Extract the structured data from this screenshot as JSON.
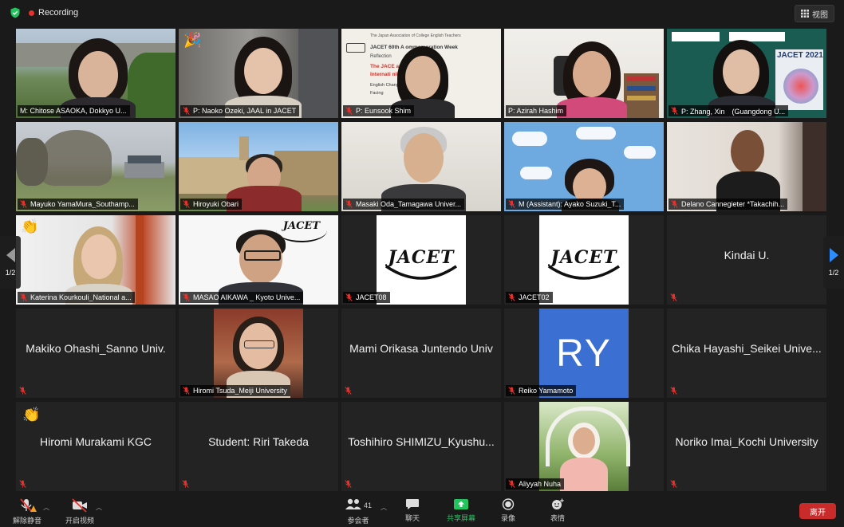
{
  "topbar": {
    "recording_label": "Recording",
    "view_label": "视图"
  },
  "pager": {
    "left_label": "1/2",
    "right_label": "1/2"
  },
  "tiles": [
    {
      "name": "M: Chitose ASAOKA, Dokkyo U..."
    },
    {
      "name": "P: Naoko Ozeki, JAAL in JACET"
    },
    {
      "name": "P: Eunsook Shim"
    },
    {
      "name": "P: Azirah Hashim"
    },
    {
      "name": "P: Zhang, Xin　(Guangdong U..."
    },
    {
      "name": "Mayuko YamaMura_Southamp..."
    },
    {
      "name": "Hiroyuki Obari"
    },
    {
      "name": "Masaki Oda_Tamagawa Univer..."
    },
    {
      "name": "M (Assistant): Ayako Suzuki_T..."
    },
    {
      "name": "Delano Cannegieter *Takachih..."
    },
    {
      "name": "Katerina Kourkouli_National a..."
    },
    {
      "name": "MASAO AIKAWA _ Kyoto Unive..."
    },
    {
      "name": "JACET08",
      "logo": "JACET"
    },
    {
      "name": "JACET02",
      "logo": "JACET"
    },
    {
      "name": "Kindai U."
    },
    {
      "name": "Makiko Ohashi_Sanno Univ."
    },
    {
      "name": "Hiromi Tsuda_Meiji University"
    },
    {
      "name": "Mami Orikasa Juntendo Univ"
    },
    {
      "name": "Reiko Yamamoto",
      "initials": "RY"
    },
    {
      "name": "Chika Hayashi_Seikei Unive..."
    },
    {
      "name": "Hiromi Murakami KGC"
    },
    {
      "name": "Student: Riri Takeda"
    },
    {
      "name": "Toshihiro SHIMIZU_Kyushu..."
    },
    {
      "name": "Aliyyah Nuha"
    },
    {
      "name": "Noriko Imai_Kochi University"
    }
  ],
  "slide": {
    "header": "The Japan Association of College English Teachers",
    "line1": "JACET 60th A   ommemoration Week",
    "line2": "Reflection",
    "line3": "The JACE         ative",
    "line4": "Internati          nline, 2021)",
    "line5": "English                 Changing Times:",
    "line6": "Facing"
  },
  "poster": {
    "title": "JACET 2021"
  },
  "toolbar": {
    "unmute_label": "解除静音",
    "video_label": "开启视频",
    "participants_label": "参会者",
    "participants_count": "41",
    "chat_label": "聊天",
    "share_label": "共享屏幕",
    "record_label": "录像",
    "reactions_label": "表情",
    "leave_label": "离开"
  },
  "colors": {
    "accent_blue": "#2d8cff",
    "share_green": "#23c45e",
    "leave_red": "#c92b2b",
    "active_outline": "#c9dc2e",
    "initials_bg": "#3c6fd2"
  }
}
